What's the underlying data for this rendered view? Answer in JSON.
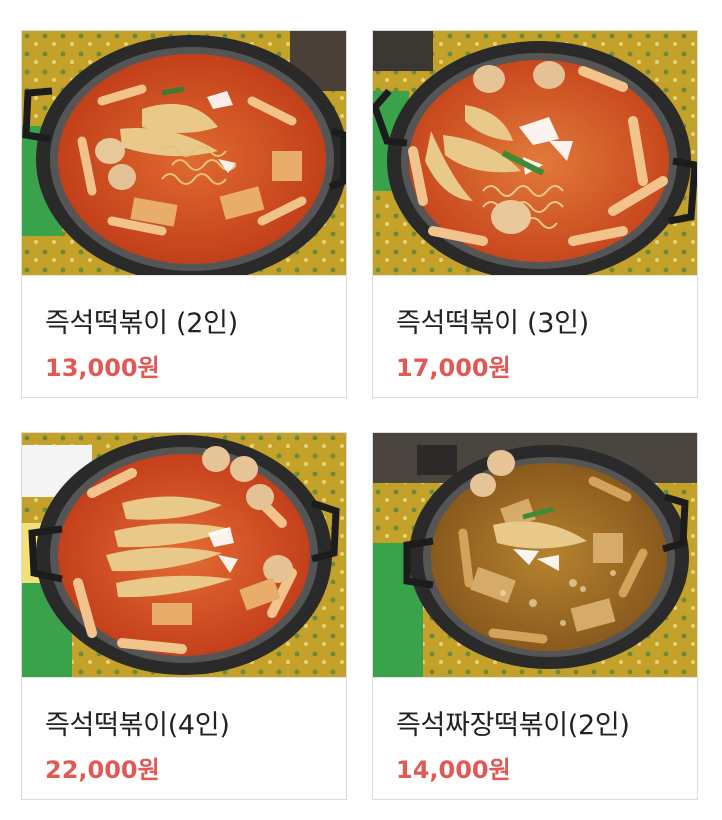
{
  "colors": {
    "price": "#e05a55",
    "name": "#222222",
    "card_border": "#dcdcdc",
    "table_yellow": "#c9a72c",
    "pan": "#2b2b2b",
    "sauce": "#d24a1c",
    "jjajang_sauce": "#9a6a24"
  },
  "menu": {
    "items": [
      {
        "name": "즉석떡볶이 (2인)",
        "price": "13,000원",
        "photo": "tteokbokki-pan-photo"
      },
      {
        "name": "즉석떡볶이 (3인)",
        "price": "17,000원",
        "photo": "tteokbokki-pan-photo"
      },
      {
        "name": "즉석떡볶이(4인)",
        "price": "22,000원",
        "photo": "tteokbokki-pan-photo"
      },
      {
        "name": "즉석짜장떡볶이(2인)",
        "price": "14,000원",
        "photo": "jjajang-tteokbokki-pan-photo"
      }
    ]
  }
}
